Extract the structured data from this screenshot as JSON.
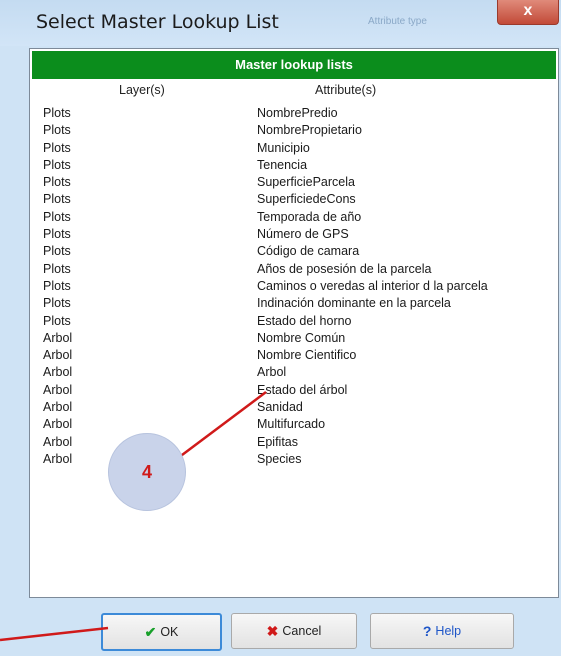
{
  "window": {
    "title": "Select Master Lookup List",
    "ghost_text": "Attribute type",
    "close_glyph": "x"
  },
  "panel": {
    "header": "Master lookup lists",
    "columns": {
      "layer": "Layer(s)",
      "attribute": "Attribute(s)"
    }
  },
  "rows": [
    {
      "layer": "Plots",
      "attribute": "NombrePredio"
    },
    {
      "layer": "Plots",
      "attribute": "NombrePropietario"
    },
    {
      "layer": "Plots",
      "attribute": "Municipio"
    },
    {
      "layer": "Plots",
      "attribute": "Tenencia"
    },
    {
      "layer": "Plots",
      "attribute": "SuperficieParcela"
    },
    {
      "layer": "Plots",
      "attribute": "SuperficiedeCons"
    },
    {
      "layer": "Plots",
      "attribute": "Temporada de año"
    },
    {
      "layer": "Plots",
      "attribute": "Número de GPS"
    },
    {
      "layer": "Plots",
      "attribute": "Código de camara"
    },
    {
      "layer": "Plots",
      "attribute": "Años de posesión de la parcela"
    },
    {
      "layer": "Plots",
      "attribute": "Caminos o veredas al interior d la parcela"
    },
    {
      "layer": "Plots",
      "attribute": "Indinación dominante en la parcela"
    },
    {
      "layer": "Plots",
      "attribute": "Estado del horno"
    },
    {
      "layer": "Arbol",
      "attribute": "Nombre Común"
    },
    {
      "layer": "Arbol",
      "attribute": "Nombre Cientifico"
    },
    {
      "layer": "Arbol",
      "attribute": "Arbol"
    },
    {
      "layer": "Arbol",
      "attribute": "Estado del árbol"
    },
    {
      "layer": "Arbol",
      "attribute": "Sanidad"
    },
    {
      "layer": "Arbol",
      "attribute": "Multifurcado"
    },
    {
      "layer": "Arbol",
      "attribute": "Epifitas"
    },
    {
      "layer": "Arbol",
      "attribute": "Species"
    }
  ],
  "buttons": {
    "ok": "OK",
    "cancel": "Cancel",
    "help_prefix": "?",
    "help": "Help"
  },
  "icons": {
    "ok": "check-icon",
    "cancel": "x-icon",
    "help": "question-icon"
  },
  "annotation": {
    "number": "4"
  },
  "colors": {
    "header": "#0b8d1c",
    "annotation_line": "#d01a1a",
    "callout_bg": "#c9d3ea"
  }
}
